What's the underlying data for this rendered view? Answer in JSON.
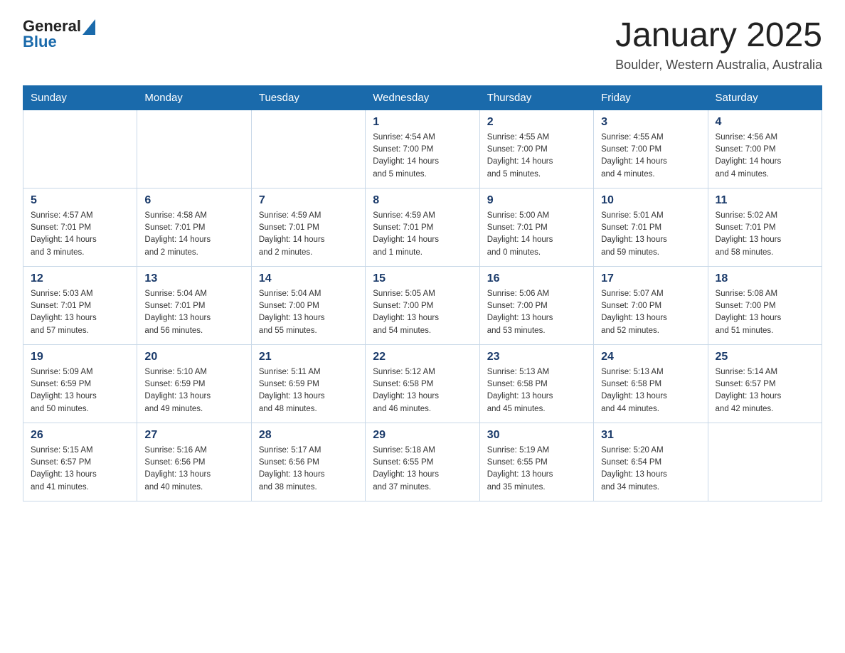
{
  "header": {
    "logo_general": "General",
    "logo_blue": "Blue",
    "month_title": "January 2025",
    "location": "Boulder, Western Australia, Australia"
  },
  "weekdays": [
    "Sunday",
    "Monday",
    "Tuesday",
    "Wednesday",
    "Thursday",
    "Friday",
    "Saturday"
  ],
  "weeks": [
    [
      {
        "day": "",
        "info": ""
      },
      {
        "day": "",
        "info": ""
      },
      {
        "day": "",
        "info": ""
      },
      {
        "day": "1",
        "info": "Sunrise: 4:54 AM\nSunset: 7:00 PM\nDaylight: 14 hours\nand 5 minutes."
      },
      {
        "day": "2",
        "info": "Sunrise: 4:55 AM\nSunset: 7:00 PM\nDaylight: 14 hours\nand 5 minutes."
      },
      {
        "day": "3",
        "info": "Sunrise: 4:55 AM\nSunset: 7:00 PM\nDaylight: 14 hours\nand 4 minutes."
      },
      {
        "day": "4",
        "info": "Sunrise: 4:56 AM\nSunset: 7:00 PM\nDaylight: 14 hours\nand 4 minutes."
      }
    ],
    [
      {
        "day": "5",
        "info": "Sunrise: 4:57 AM\nSunset: 7:01 PM\nDaylight: 14 hours\nand 3 minutes."
      },
      {
        "day": "6",
        "info": "Sunrise: 4:58 AM\nSunset: 7:01 PM\nDaylight: 14 hours\nand 2 minutes."
      },
      {
        "day": "7",
        "info": "Sunrise: 4:59 AM\nSunset: 7:01 PM\nDaylight: 14 hours\nand 2 minutes."
      },
      {
        "day": "8",
        "info": "Sunrise: 4:59 AM\nSunset: 7:01 PM\nDaylight: 14 hours\nand 1 minute."
      },
      {
        "day": "9",
        "info": "Sunrise: 5:00 AM\nSunset: 7:01 PM\nDaylight: 14 hours\nand 0 minutes."
      },
      {
        "day": "10",
        "info": "Sunrise: 5:01 AM\nSunset: 7:01 PM\nDaylight: 13 hours\nand 59 minutes."
      },
      {
        "day": "11",
        "info": "Sunrise: 5:02 AM\nSunset: 7:01 PM\nDaylight: 13 hours\nand 58 minutes."
      }
    ],
    [
      {
        "day": "12",
        "info": "Sunrise: 5:03 AM\nSunset: 7:01 PM\nDaylight: 13 hours\nand 57 minutes."
      },
      {
        "day": "13",
        "info": "Sunrise: 5:04 AM\nSunset: 7:01 PM\nDaylight: 13 hours\nand 56 minutes."
      },
      {
        "day": "14",
        "info": "Sunrise: 5:04 AM\nSunset: 7:00 PM\nDaylight: 13 hours\nand 55 minutes."
      },
      {
        "day": "15",
        "info": "Sunrise: 5:05 AM\nSunset: 7:00 PM\nDaylight: 13 hours\nand 54 minutes."
      },
      {
        "day": "16",
        "info": "Sunrise: 5:06 AM\nSunset: 7:00 PM\nDaylight: 13 hours\nand 53 minutes."
      },
      {
        "day": "17",
        "info": "Sunrise: 5:07 AM\nSunset: 7:00 PM\nDaylight: 13 hours\nand 52 minutes."
      },
      {
        "day": "18",
        "info": "Sunrise: 5:08 AM\nSunset: 7:00 PM\nDaylight: 13 hours\nand 51 minutes."
      }
    ],
    [
      {
        "day": "19",
        "info": "Sunrise: 5:09 AM\nSunset: 6:59 PM\nDaylight: 13 hours\nand 50 minutes."
      },
      {
        "day": "20",
        "info": "Sunrise: 5:10 AM\nSunset: 6:59 PM\nDaylight: 13 hours\nand 49 minutes."
      },
      {
        "day": "21",
        "info": "Sunrise: 5:11 AM\nSunset: 6:59 PM\nDaylight: 13 hours\nand 48 minutes."
      },
      {
        "day": "22",
        "info": "Sunrise: 5:12 AM\nSunset: 6:58 PM\nDaylight: 13 hours\nand 46 minutes."
      },
      {
        "day": "23",
        "info": "Sunrise: 5:13 AM\nSunset: 6:58 PM\nDaylight: 13 hours\nand 45 minutes."
      },
      {
        "day": "24",
        "info": "Sunrise: 5:13 AM\nSunset: 6:58 PM\nDaylight: 13 hours\nand 44 minutes."
      },
      {
        "day": "25",
        "info": "Sunrise: 5:14 AM\nSunset: 6:57 PM\nDaylight: 13 hours\nand 42 minutes."
      }
    ],
    [
      {
        "day": "26",
        "info": "Sunrise: 5:15 AM\nSunset: 6:57 PM\nDaylight: 13 hours\nand 41 minutes."
      },
      {
        "day": "27",
        "info": "Sunrise: 5:16 AM\nSunset: 6:56 PM\nDaylight: 13 hours\nand 40 minutes."
      },
      {
        "day": "28",
        "info": "Sunrise: 5:17 AM\nSunset: 6:56 PM\nDaylight: 13 hours\nand 38 minutes."
      },
      {
        "day": "29",
        "info": "Sunrise: 5:18 AM\nSunset: 6:55 PM\nDaylight: 13 hours\nand 37 minutes."
      },
      {
        "day": "30",
        "info": "Sunrise: 5:19 AM\nSunset: 6:55 PM\nDaylight: 13 hours\nand 35 minutes."
      },
      {
        "day": "31",
        "info": "Sunrise: 5:20 AM\nSunset: 6:54 PM\nDaylight: 13 hours\nand 34 minutes."
      },
      {
        "day": "",
        "info": ""
      }
    ]
  ]
}
